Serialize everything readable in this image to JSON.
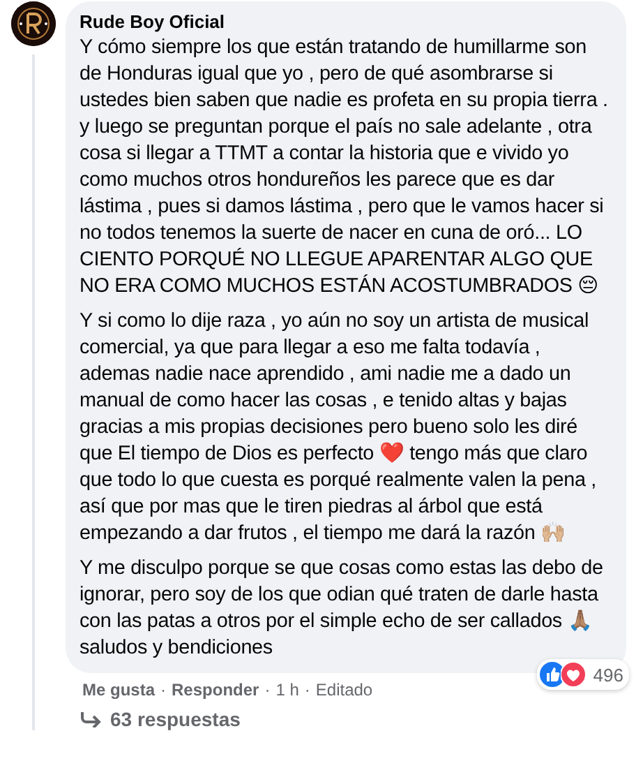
{
  "comment": {
    "author": "Rude Boy Oficial",
    "paragraphs": [
      "Y cómo siempre los que están tratando de humillarme son de Honduras igual que yo , pero de qué asombrarse si ustedes bien saben que nadie es profeta en su propia tierra .\ny luego se preguntan porque el país no sale adelante , otra cosa si llegar a TTMT a contar la historia que e vivido yo como muchos otros hondureños les parece que es dar lástima , pues si damos lástima , pero que le vamos hacer si no todos tenemos la suerte de nacer en cuna de oró... LO CIENTO PORQUÉ NO LLEGUE APARENTAR ALGO QUE NO ERA COMO MUCHOS ESTÁN ACOSTUMBRADOS 😔",
      "Y si como lo dije raza , yo aún no soy un artista de musical comercial, ya que para llegar a eso me falta todavía , ademas nadie nace aprendido , ami nadie me a dado un manual de como hacer las cosas , e tenido altas y bajas gracias a mis propias decisiones pero bueno solo les diré que El tiempo de Dios es perfecto ❤️ tengo más que claro que todo lo que cuesta es porqué realmente valen la pena , así que por mas que le tiren piedras al árbol que está empezando a dar frutos , el tiempo me dará la razón 🙌🏼",
      "Y me disculpo porque se que cosas como estas las debo de ignorar, pero soy de los que odian qué traten de darle hasta con las patas a otros por el simple echo de ser callados 🙏🏽 saludos y bendiciones"
    ],
    "reactions": {
      "count": "496"
    },
    "actions": [
      {
        "label": "Me gusta",
        "kind": "link"
      },
      {
        "label": "·",
        "kind": "sep"
      },
      {
        "label": "Responder",
        "kind": "link"
      },
      {
        "label": "·",
        "kind": "sep"
      },
      {
        "label": "1 h",
        "kind": "time"
      },
      {
        "label": "·",
        "kind": "sep"
      },
      {
        "label": "Editado",
        "kind": "time"
      }
    ],
    "replies": "63 respuestas"
  }
}
